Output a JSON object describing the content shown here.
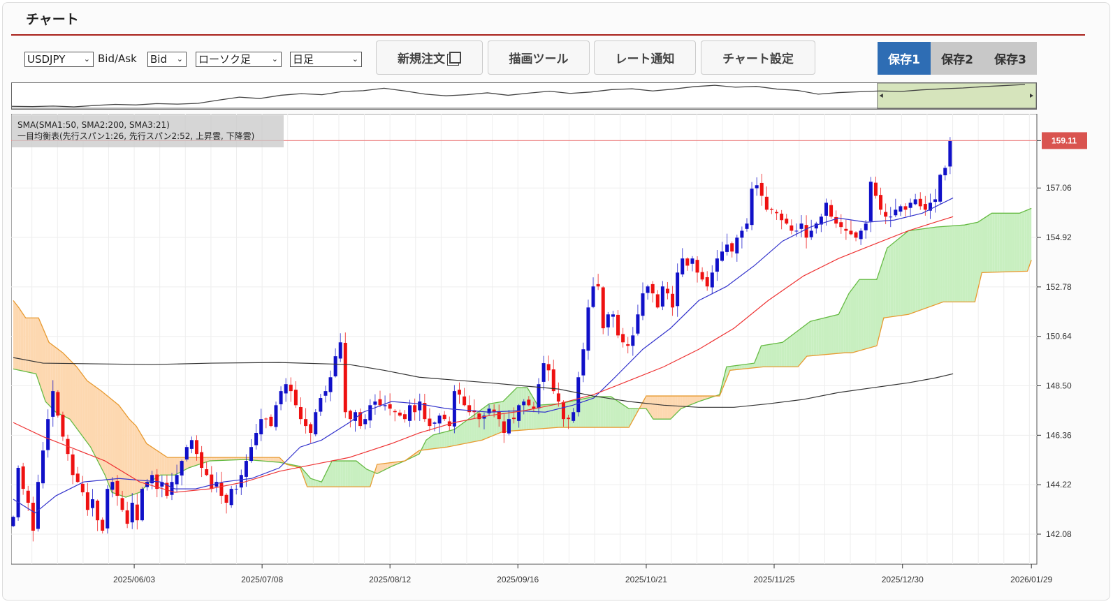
{
  "header": {
    "title": "チャート"
  },
  "controls": {
    "symbol": "USDJPY",
    "bidask_label": "Bid/Ask",
    "bidask": "Bid",
    "chart_type": "ローソク足",
    "timeframe": "日足"
  },
  "buttons": {
    "new_order": "新規注文",
    "drawing_tools": "描画ツール",
    "rate_alert": "レート通知",
    "chart_settings": "チャート設定"
  },
  "save_tabs": [
    {
      "label": "保存1",
      "active": true
    },
    {
      "label": "保存2",
      "active": false
    },
    {
      "label": "保存3",
      "active": false
    }
  ],
  "legend": {
    "line1": "SMA(SMA1:50, SMA2:200, SMA3:21)",
    "line2": "一目均衡表(先行スパン1:26, 先行スパン2:52, 上昇雲, 下降雲)"
  },
  "colors": {
    "up": "#1010c8",
    "down": "#ee1111",
    "sma21": "#3333cc",
    "sma50": "#ee3333",
    "sma200": "#333333",
    "span1": "#66bb44",
    "span2": "#e89a30",
    "cloud_up": "#c8efc0",
    "cloud_down": "#fdd8b0",
    "current": "#d9534f"
  },
  "chart_data": {
    "type": "candlestick",
    "current_price": "159.11",
    "ylim": [
      140.78,
      160.27
    ],
    "xlim": [
      -0.42,
      206.5
    ],
    "yticks": [
      "142.08",
      "144.22",
      "146.36",
      "148.50",
      "150.64",
      "152.78",
      "154.92",
      "157.06"
    ],
    "xticks": [
      {
        "label": "2025/06/03",
        "at": 24.4
      },
      {
        "label": "2025/07/08",
        "at": 50.2
      },
      {
        "label": "2025/08/12",
        "at": 76.0
      },
      {
        "label": "2025/09/16",
        "at": 101.8
      },
      {
        "label": "2025/10/21",
        "at": 127.7
      },
      {
        "label": "2025/11/25",
        "at": 153.5
      },
      {
        "label": "2025/12/30",
        "at": 179.4
      },
      {
        "label": "2026/01/29",
        "at": 205.4
      }
    ],
    "closes": [
      142.83,
      144.95,
      144.04,
      143.44,
      142.23,
      144.34,
      145.7,
      147.06,
      148.27,
      147.21,
      146.3,
      145.55,
      144.64,
      144.34,
      143.89,
      143.13,
      143.59,
      142.68,
      142.23,
      144.04,
      144.34,
      143.74,
      143.13,
      142.53,
      143.44,
      142.68,
      144.04,
      144.34,
      144.64,
      144.04,
      144.34,
      143.74,
      144.34,
      144.64,
      145.25,
      145.85,
      146.15,
      145.55,
      144.95,
      144.64,
      144.04,
      144.34,
      143.74,
      143.44,
      144.04,
      144.04,
      144.64,
      145.25,
      145.85,
      146.46,
      147.06,
      147.06,
      146.76,
      147.66,
      148.27,
      148.57,
      148.27,
      147.66,
      147.06,
      146.76,
      146.46,
      147.36,
      147.97,
      148.27,
      148.87,
      149.78,
      150.38,
      147.36,
      147.06,
      147.36,
      146.76,
      147.06,
      147.66,
      147.82,
      147.66,
      147.66,
      147.51,
      147.36,
      147.21,
      147.06,
      147.66,
      147.36,
      147.82,
      147.06,
      146.76,
      146.91,
      147.21,
      147.06,
      146.76,
      148.27,
      148.12,
      147.66,
      147.36,
      147.36,
      147.06,
      147.21,
      147.51,
      147.36,
      147.06,
      146.46,
      147.06,
      147.06,
      147.66,
      147.82,
      147.66,
      147.51,
      148.57,
      149.48,
      149.17,
      148.27,
      147.82,
      147.06,
      147.06,
      147.36,
      148.87,
      150.08,
      151.89,
      152.8,
      152.8,
      150.99,
      151.59,
      151.59,
      150.68,
      150.38,
      150.23,
      150.68,
      151.59,
      152.5,
      152.8,
      152.5,
      151.89,
      152.8,
      152.5,
      151.89,
      153.4,
      154.01,
      153.7,
      154.01,
      153.4,
      153.1,
      152.8,
      153.4,
      154.01,
      154.31,
      154.61,
      154.31,
      154.91,
      155.21,
      155.52,
      157.03,
      157.18,
      156.72,
      156.12,
      156.12,
      155.97,
      155.67,
      155.52,
      155.21,
      155.21,
      155.52,
      154.91,
      155.21,
      155.52,
      155.82,
      156.42,
      155.82,
      155.52,
      155.37,
      155.21,
      155.06,
      154.91,
      155.21,
      155.52,
      157.33,
      156.72,
      156.12,
      155.82,
      155.82,
      156.12,
      156.27,
      156.12,
      156.42,
      156.57,
      156.27,
      156.12,
      156.42,
      156.57,
      157.63,
      157.93,
      159.11
    ],
    "series": [
      {
        "name": "SMA3:21",
        "color_key": "sma21",
        "points": [
          [
            0,
            143.59
          ],
          [
            4.4,
            143.0
          ],
          [
            8.6,
            143.74
          ],
          [
            14.2,
            144.34
          ],
          [
            21.3,
            144.49
          ],
          [
            29.7,
            144.34
          ],
          [
            32.6,
            144.04
          ],
          [
            36.8,
            144.04
          ],
          [
            42.4,
            144.34
          ],
          [
            48.1,
            144.49
          ],
          [
            53.7,
            144.95
          ],
          [
            57.9,
            145.85
          ],
          [
            62.2,
            146.15
          ],
          [
            67.8,
            146.91
          ],
          [
            70.6,
            147.36
          ],
          [
            76.3,
            147.82
          ],
          [
            81.9,
            147.72
          ],
          [
            87.5,
            147.51
          ],
          [
            96,
            147.36
          ],
          [
            101.8,
            147.42
          ],
          [
            107.3,
            147.36
          ],
          [
            112.9,
            147.66
          ],
          [
            117.1,
            147.97
          ],
          [
            121.4,
            148.87
          ],
          [
            127,
            150.08
          ],
          [
            132.6,
            150.99
          ],
          [
            138.3,
            152.19
          ],
          [
            143.9,
            152.8
          ],
          [
            149.5,
            153.7
          ],
          [
            155.2,
            154.76
          ],
          [
            160.8,
            155.37
          ],
          [
            166.5,
            155.76
          ],
          [
            172.1,
            155.58
          ],
          [
            177.7,
            155.67
          ],
          [
            183.4,
            155.97
          ],
          [
            189.6,
            156.63
          ]
        ]
      },
      {
        "name": "SMA1:50",
        "color_key": "sma50",
        "points": [
          [
            0,
            146.91
          ],
          [
            6,
            146.3
          ],
          [
            11.4,
            145.85
          ],
          [
            18.5,
            145.25
          ],
          [
            25.5,
            144.34
          ],
          [
            32.6,
            143.89
          ],
          [
            39.6,
            144.04
          ],
          [
            46.7,
            144.34
          ],
          [
            53.7,
            144.8
          ],
          [
            60.7,
            145.1
          ],
          [
            67.8,
            145.4
          ],
          [
            76.3,
            146.0
          ],
          [
            81.9,
            146.46
          ],
          [
            89,
            146.91
          ],
          [
            96,
            147.21
          ],
          [
            103,
            147.42
          ],
          [
            110,
            147.72
          ],
          [
            117.1,
            148.12
          ],
          [
            124.2,
            148.72
          ],
          [
            131.2,
            149.32
          ],
          [
            138.3,
            150.08
          ],
          [
            145.4,
            150.99
          ],
          [
            152.3,
            152.19
          ],
          [
            159.4,
            153.25
          ],
          [
            166.5,
            154.01
          ],
          [
            173.5,
            154.61
          ],
          [
            180.6,
            155.21
          ],
          [
            186,
            155.58
          ],
          [
            189.6,
            155.82
          ]
        ]
      },
      {
        "name": "SMA2:200",
        "color_key": "sma200",
        "points": [
          [
            0,
            149.72
          ],
          [
            6,
            149.48
          ],
          [
            28,
            149.42
          ],
          [
            40,
            149.48
          ],
          [
            53.7,
            149.51
          ],
          [
            67.8,
            149.42
          ],
          [
            74.8,
            149.17
          ],
          [
            81.9,
            148.87
          ],
          [
            96,
            148.63
          ],
          [
            110,
            148.36
          ],
          [
            117,
            148.06
          ],
          [
            124.2,
            147.82
          ],
          [
            131.2,
            147.66
          ],
          [
            138.3,
            147.57
          ],
          [
            145.4,
            147.57
          ],
          [
            152.3,
            147.72
          ],
          [
            159.4,
            147.91
          ],
          [
            166.5,
            148.21
          ],
          [
            173.5,
            148.42
          ],
          [
            180.6,
            148.63
          ],
          [
            186,
            148.84
          ],
          [
            189.6,
            149.02
          ]
        ]
      }
    ],
    "ichimoku": {
      "span1": [
        [
          0,
          149.23
        ],
        [
          4.6,
          149.02
        ],
        [
          6.5,
          147.82
        ],
        [
          8.6,
          147.36
        ],
        [
          11.4,
          147.06
        ],
        [
          15.6,
          145.85
        ],
        [
          18.5,
          144.64
        ],
        [
          19.9,
          143.89
        ],
        [
          22.7,
          143.68
        ],
        [
          25.5,
          143.89
        ],
        [
          27.6,
          144.34
        ],
        [
          29.7,
          144.64
        ],
        [
          32.6,
          144.64
        ],
        [
          35.4,
          144.95
        ],
        [
          39.6,
          145.25
        ],
        [
          46.7,
          145.31
        ],
        [
          53.7,
          145.19
        ],
        [
          57.9,
          145.01
        ],
        [
          60,
          144.49
        ],
        [
          62.2,
          144.34
        ],
        [
          64.3,
          145.25
        ],
        [
          69.2,
          145.25
        ],
        [
          71.3,
          144.89
        ],
        [
          73.4,
          144.7
        ],
        [
          76.3,
          145.01
        ],
        [
          79,
          145.25
        ],
        [
          81.9,
          145.55
        ],
        [
          83.3,
          146.15
        ],
        [
          84.7,
          146.37
        ],
        [
          89,
          146.61
        ],
        [
          96,
          147.72
        ],
        [
          98.8,
          147.82
        ],
        [
          101.6,
          148.42
        ],
        [
          103.7,
          148.42
        ],
        [
          105.8,
          147.66
        ],
        [
          110,
          147.72
        ],
        [
          117.1,
          148.03
        ],
        [
          120.6,
          148.03
        ],
        [
          124.2,
          147.51
        ],
        [
          127.7,
          147.51
        ],
        [
          129.1,
          147.06
        ],
        [
          132.6,
          147.06
        ],
        [
          134.7,
          147.51
        ],
        [
          138.3,
          147.82
        ],
        [
          142.5,
          148.12
        ],
        [
          143.9,
          149.32
        ],
        [
          149.5,
          149.48
        ],
        [
          150.9,
          150.23
        ],
        [
          155.2,
          150.38
        ],
        [
          160.8,
          151.29
        ],
        [
          166.5,
          151.59
        ],
        [
          168.6,
          152.5
        ],
        [
          170.7,
          153.1
        ],
        [
          174.2,
          153.1
        ],
        [
          176.3,
          154.46
        ],
        [
          180.6,
          155.21
        ],
        [
          186.2,
          155.37
        ],
        [
          191.9,
          155.46
        ],
        [
          194.6,
          155.58
        ],
        [
          197.4,
          155.97
        ],
        [
          203,
          155.97
        ],
        [
          205.4,
          156.18
        ]
      ],
      "span2": [
        [
          0,
          152.19
        ],
        [
          1.1,
          151.89
        ],
        [
          2.5,
          151.44
        ],
        [
          5.1,
          151.44
        ],
        [
          7.2,
          150.38
        ],
        [
          10,
          149.93
        ],
        [
          12.8,
          149.32
        ],
        [
          14.9,
          148.72
        ],
        [
          17.8,
          148.27
        ],
        [
          21.3,
          147.66
        ],
        [
          23.4,
          147.06
        ],
        [
          24.8,
          146.76
        ],
        [
          26.9,
          146.0
        ],
        [
          31.1,
          145.4
        ],
        [
          53.7,
          145.4
        ],
        [
          55.1,
          145.1
        ],
        [
          57.9,
          144.95
        ],
        [
          59.3,
          144.13
        ],
        [
          72,
          144.13
        ],
        [
          73.4,
          145.1
        ],
        [
          79,
          145.25
        ],
        [
          81.9,
          145.7
        ],
        [
          87.5,
          145.85
        ],
        [
          94.6,
          146.15
        ],
        [
          98.8,
          146.52
        ],
        [
          110,
          146.7
        ],
        [
          124.2,
          146.7
        ],
        [
          127.7,
          148.06
        ],
        [
          142.5,
          148.06
        ],
        [
          144.6,
          149.17
        ],
        [
          151.3,
          149.32
        ],
        [
          158.3,
          149.32
        ],
        [
          160.1,
          149.78
        ],
        [
          167.8,
          149.93
        ],
        [
          169.2,
          149.93
        ],
        [
          174.2,
          150.23
        ],
        [
          175.6,
          151.44
        ],
        [
          180.6,
          151.59
        ],
        [
          187.6,
          152.13
        ],
        [
          194,
          152.13
        ],
        [
          195.4,
          153.4
        ],
        [
          204.6,
          153.46
        ],
        [
          205.4,
          153.94
        ]
      ]
    },
    "overview_series": [
      140.5,
      140.4,
      140.6,
      140.3,
      140.8,
      141.2,
      141.0,
      141.5,
      141.3,
      141.6,
      142.8,
      143.9,
      143.4,
      144.6,
      145.2,
      144.8,
      146.0,
      146.3,
      147.2,
      146.2,
      145.0,
      144.4,
      144.8,
      145.5,
      144.6,
      145.4,
      146.1,
      145.3,
      145.8,
      146.7,
      147.0,
      146.2,
      146.9,
      147.8,
      148.3,
      147.6,
      147.9,
      146.9,
      146.4,
      145.0,
      145.6,
      145.9,
      146.2,
      146.0,
      146.6,
      147.0,
      147.3,
      147.8,
      148.2,
      148.6
    ],
    "overview_selection_start": 0.845
  }
}
